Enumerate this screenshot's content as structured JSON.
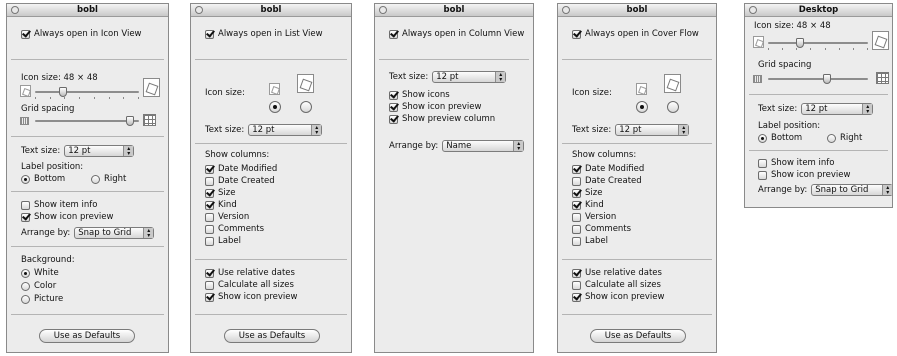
{
  "panel1": {
    "title": "bobl",
    "always_open": "Always open in Icon View",
    "icon_size": "Icon size: 48 × 48",
    "grid_spacing": "Grid spacing",
    "text_size_label": "Text size:",
    "text_size_value": "12 pt",
    "label_position": "Label position:",
    "bottom": "Bottom",
    "right": "Right",
    "show_item_info": "Show item info",
    "show_icon_preview": "Show icon preview",
    "arrange_by_label": "Arrange by:",
    "arrange_by_value": "Snap to Grid",
    "background": "Background:",
    "white": "White",
    "color": "Color",
    "picture": "Picture",
    "use_as_defaults": "Use as Defaults"
  },
  "panel2": {
    "title": "bobl",
    "always_open": "Always open in List View",
    "icon_size": "Icon size:",
    "text_size_label": "Text size:",
    "text_size_value": "12 pt",
    "show_columns": "Show columns:",
    "columns": [
      "Date Modified",
      "Date Created",
      "Size",
      "Kind",
      "Version",
      "Comments",
      "Label"
    ],
    "use_relative_dates": "Use relative dates",
    "calculate_all_sizes": "Calculate all sizes",
    "show_icon_preview": "Show icon preview",
    "use_as_defaults": "Use as Defaults"
  },
  "panel3": {
    "title": "bobl",
    "always_open": "Always open in Column View",
    "text_size_label": "Text size:",
    "text_size_value": "12 pt",
    "show_icons": "Show icons",
    "show_icon_preview": "Show icon preview",
    "show_preview_column": "Show preview column",
    "arrange_by_label": "Arrange by:",
    "arrange_by_value": "Name"
  },
  "panel4": {
    "title": "bobl",
    "always_open": "Always open in Cover Flow",
    "icon_size": "Icon size:",
    "text_size_label": "Text size:",
    "text_size_value": "12 pt",
    "show_columns": "Show columns:",
    "columns": [
      "Date Modified",
      "Date Created",
      "Size",
      "Kind",
      "Version",
      "Comments",
      "Label"
    ],
    "use_relative_dates": "Use relative dates",
    "calculate_all_sizes": "Calculate all sizes",
    "show_icon_preview": "Show icon preview",
    "use_as_defaults": "Use as Defaults"
  },
  "panel5": {
    "title": "Desktop",
    "icon_size": "Icon size: 48 × 48",
    "grid_spacing": "Grid spacing",
    "text_size_label": "Text size:",
    "text_size_value": "12 pt",
    "label_position": "Label position:",
    "bottom": "Bottom",
    "right": "Right",
    "show_item_info": "Show item info",
    "show_icon_preview": "Show icon preview",
    "arrange_by_label": "Arrange by:",
    "arrange_by_value": "Snap to Grid"
  },
  "state": {
    "icon_size_level": 0.25,
    "grid_spacing_level": 0.95,
    "desktop_icon_size_level": 0.3,
    "desktop_grid_spacing_level": 0.6,
    "list_columns_checked": [
      true,
      false,
      true,
      true,
      false,
      false,
      false
    ],
    "cover_columns_checked": [
      true,
      false,
      true,
      true,
      false,
      false,
      false
    ]
  }
}
